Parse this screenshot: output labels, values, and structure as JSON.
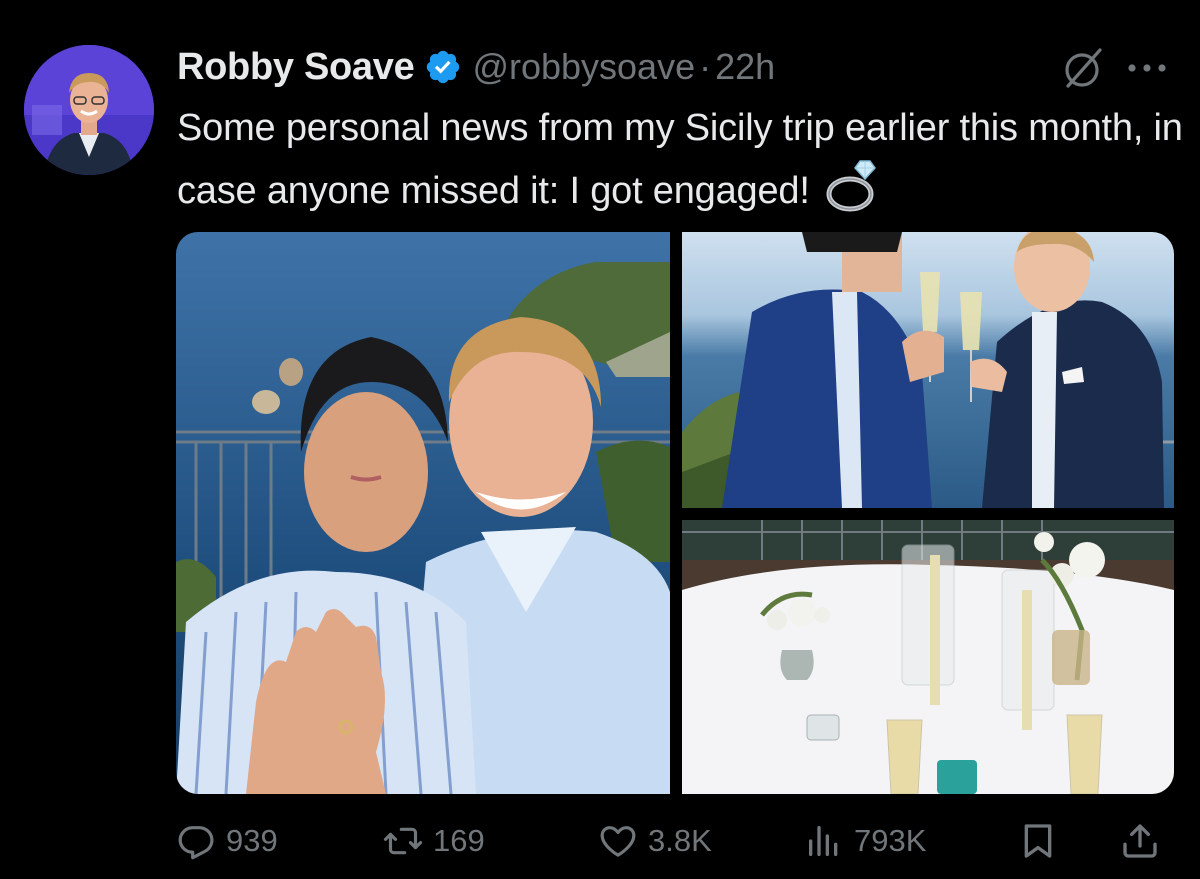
{
  "author": {
    "name": "Robby Soave",
    "handle": "@robbysoave",
    "separator": "·",
    "time": "22h",
    "verified": true
  },
  "icons": {
    "verified": "verified-badge-icon",
    "grok": "grok-icon",
    "more": "more-options-icon",
    "ring": "ring-emoji-icon"
  },
  "tweet": {
    "text": "Some personal news from my Sicily trip earlier this month, in case anyone missed it: I got engaged!"
  },
  "actions": {
    "replies": "939",
    "reposts": "169",
    "likes": "3.8K",
    "views": "793K"
  },
  "colors": {
    "background": "#000000",
    "text": "#e7e9ea",
    "muted": "#71767b",
    "verified": "#1d9bf0"
  }
}
